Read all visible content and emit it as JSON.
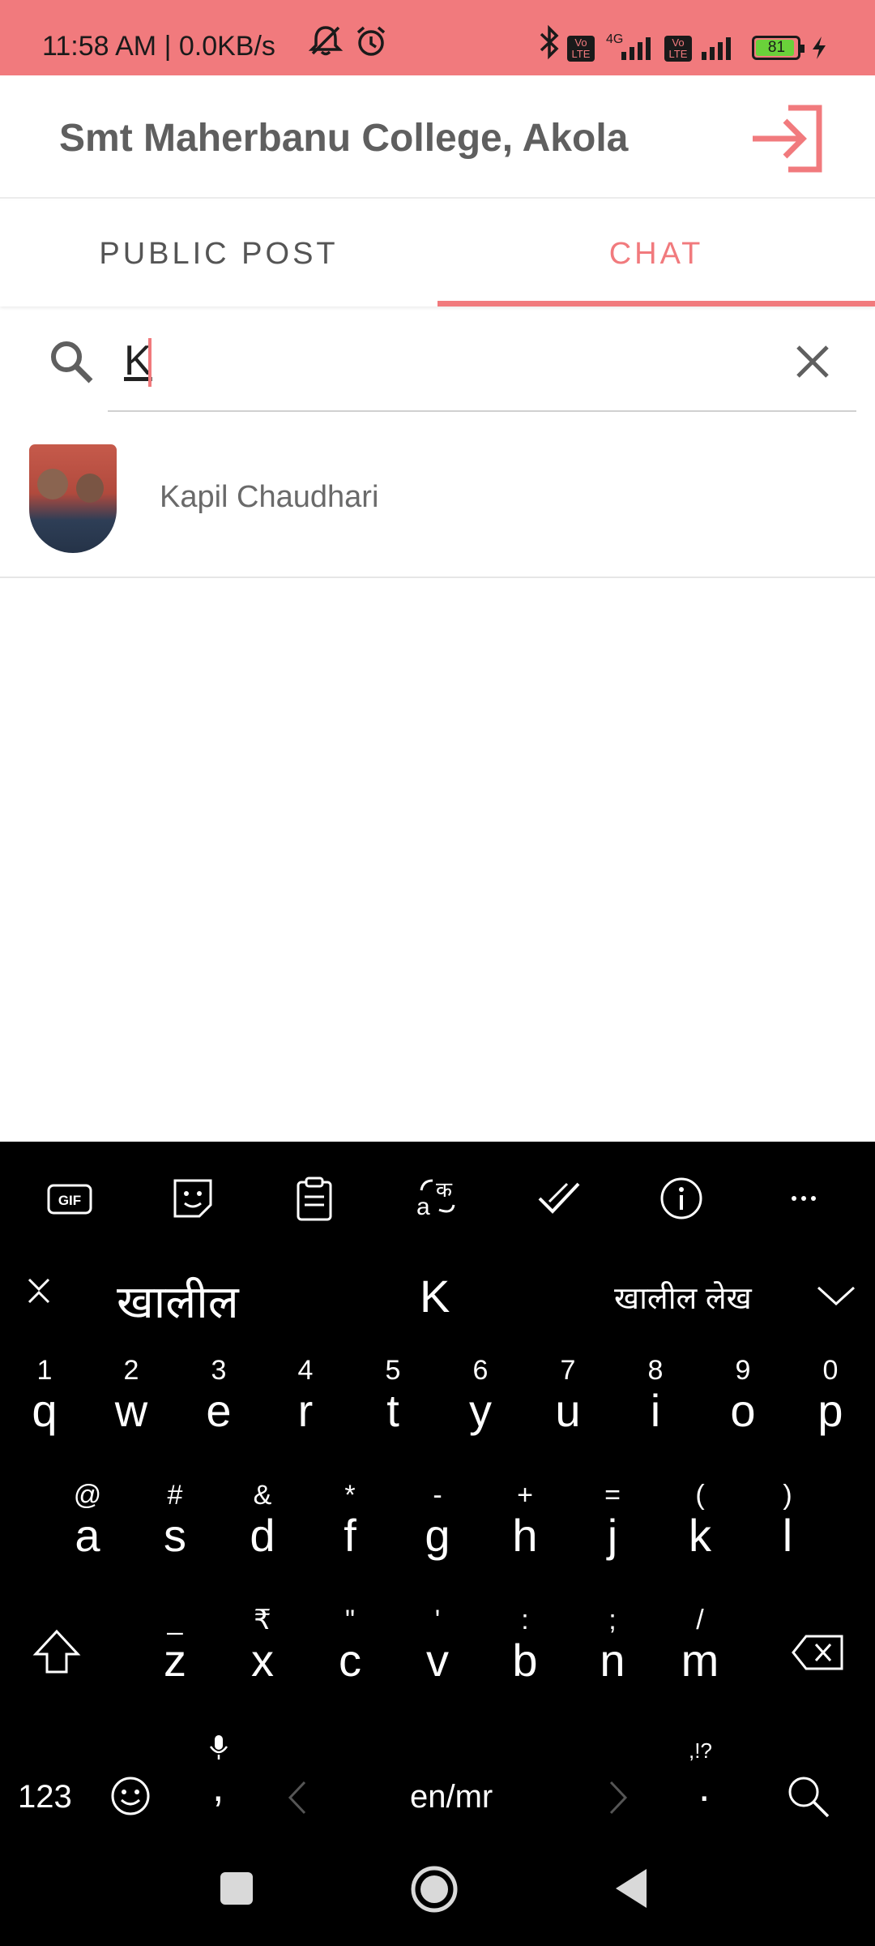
{
  "status_bar": {
    "time": "11:58 AM | 0.0KB/s",
    "network": "4G",
    "volte_1": "Vo LTE",
    "volte_2": "Vo LTE",
    "battery_percent": "81",
    "icons": [
      "mute-icon",
      "alarm-icon",
      "bluetooth-icon",
      "volte-icon",
      "signal-icon",
      "battery-icon",
      "charging-icon"
    ]
  },
  "header": {
    "title": "Smt Maherbanu College, Akola",
    "logout_icon": "login-icon"
  },
  "tabs": [
    {
      "label": "PUBLIC POST",
      "active": false
    },
    {
      "label": "CHAT",
      "active": true
    }
  ],
  "search": {
    "value": "K",
    "search_icon": "search-icon",
    "clear_icon": "close-icon"
  },
  "results": [
    {
      "name": "Kapil Chaudhari",
      "avatar": "photo"
    }
  ],
  "keyboard": {
    "toolbar": [
      "gif-icon",
      "sticker-icon",
      "clipboard-icon",
      "translate-icon",
      "checkmark-icon",
      "info-icon",
      "more-icon"
    ],
    "gif_label": "GIF",
    "suggestions": {
      "left": "खालील",
      "center": "K",
      "right": "खालील लेख"
    },
    "row1": [
      {
        "sec": "1",
        "pri": "q"
      },
      {
        "sec": "2",
        "pri": "w"
      },
      {
        "sec": "3",
        "pri": "e"
      },
      {
        "sec": "4",
        "pri": "r"
      },
      {
        "sec": "5",
        "pri": "t"
      },
      {
        "sec": "6",
        "pri": "y"
      },
      {
        "sec": "7",
        "pri": "u"
      },
      {
        "sec": "8",
        "pri": "i"
      },
      {
        "sec": "9",
        "pri": "o"
      },
      {
        "sec": "0",
        "pri": "p"
      }
    ],
    "row2": [
      {
        "sec": "@",
        "pri": "a"
      },
      {
        "sec": "#",
        "pri": "s"
      },
      {
        "sec": "&",
        "pri": "d"
      },
      {
        "sec": "*",
        "pri": "f"
      },
      {
        "sec": "-",
        "pri": "g"
      },
      {
        "sec": "+",
        "pri": "h"
      },
      {
        "sec": "=",
        "pri": "j"
      },
      {
        "sec": "(",
        "pri": "k"
      },
      {
        "sec": ")",
        "pri": "l"
      }
    ],
    "row3": [
      {
        "sec": "_",
        "pri": "z"
      },
      {
        "sec": "₹",
        "pri": "x"
      },
      {
        "sec": "\"",
        "pri": "c"
      },
      {
        "sec": "'",
        "pri": "v"
      },
      {
        "sec": ":",
        "pri": "b"
      },
      {
        "sec": ";",
        "pri": "n"
      },
      {
        "sec": "/",
        "pri": "m"
      }
    ],
    "bottom": {
      "numbers": "123",
      "comma": ",",
      "space_label": "en/mr",
      "period": ".",
      "punct": ",!?"
    }
  }
}
